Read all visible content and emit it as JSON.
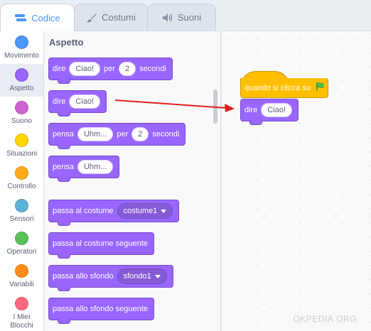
{
  "tabs": [
    {
      "label": "Codice",
      "icon": "code-icon",
      "active": true
    },
    {
      "label": "Costumi",
      "icon": "brush-icon",
      "active": false
    },
    {
      "label": "Suoni",
      "icon": "speaker-icon",
      "active": false
    }
  ],
  "categories": [
    {
      "label": "Movimento",
      "color": "#4c97ff"
    },
    {
      "label": "Aspetto",
      "color": "#9966ff",
      "active": true
    },
    {
      "label": "Suono",
      "color": "#cf63cf"
    },
    {
      "label": "Situazioni",
      "color": "#ffd500"
    },
    {
      "label": "Controllo",
      "color": "#ffab19"
    },
    {
      "label": "Sensori",
      "color": "#5cb1d6"
    },
    {
      "label": "Operatori",
      "color": "#59c059"
    },
    {
      "label": "Variabili",
      "color": "#ff8c1a"
    },
    {
      "label": "I Miei Blocchi",
      "color": "#ff6680"
    }
  ],
  "palette": {
    "title": "Aspetto",
    "blocks": {
      "say_for": {
        "word": "dire",
        "text": "Ciao!",
        "per": "per",
        "secs": "2",
        "unit": "secondi"
      },
      "say": {
        "word": "dire",
        "text": "Ciao!"
      },
      "think_for": {
        "word": "pensa",
        "text": "Uhm...",
        "per": "per",
        "secs": "2",
        "unit": "secondi"
      },
      "think": {
        "word": "pensa",
        "text": "Uhm..."
      },
      "switch_costume": {
        "word": "passa al costume",
        "value": "costume1"
      },
      "next_costume": {
        "word": "passa al costume seguente"
      },
      "switch_backdrop": {
        "word": "passa allo sfondo",
        "value": "sfondo1"
      },
      "next_backdrop": {
        "word": "passa allo sfondo seguente"
      }
    }
  },
  "workspace": {
    "hat_label": "quando si clicca su",
    "hat_icon": "green-flag-icon",
    "say_word": "dire",
    "say_text": "Ciao!"
  },
  "watermark": "OKPEDIA.ORG",
  "colors": {
    "looks": "#9966ff",
    "events": "#ffbf00",
    "accent": "#4c97ff",
    "arrow": "#e02020"
  }
}
